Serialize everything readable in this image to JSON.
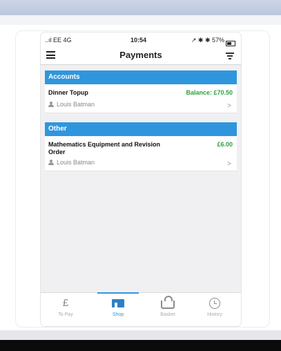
{
  "status_bar": {
    "carrier": "..ıl EE  4G",
    "time": "10:54",
    "battery": "↗ ✱ ✱ 57%"
  },
  "header": {
    "title": "Payments",
    "menu_icon": "hamburger-menu-icon",
    "filter_icon": "filter-icon"
  },
  "sections": [
    {
      "header": "Accounts",
      "items": [
        {
          "title": "Dinner Topup",
          "amount": "Balance: £70.50",
          "user": "Louis Batman"
        }
      ]
    },
    {
      "header": "Other",
      "items": [
        {
          "title": "Mathematics Equipment and Revision Order",
          "amount": "£6.00",
          "user": "Louis Batman"
        }
      ]
    }
  ],
  "tabbar": {
    "tabs": [
      {
        "label": "To Pay",
        "icon": "pound-icon"
      },
      {
        "label": "Shop",
        "icon": "shop-icon",
        "active": true
      },
      {
        "label": "Basket",
        "icon": "basket-icon"
      },
      {
        "label": "History",
        "icon": "clock-icon"
      }
    ]
  },
  "colors": {
    "accent": "#2f96dd",
    "amount_green": "#2e9f3d"
  }
}
